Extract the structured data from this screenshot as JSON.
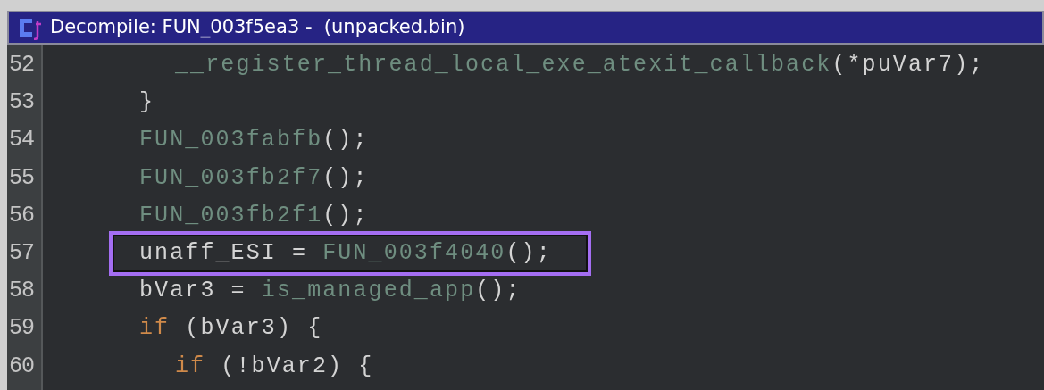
{
  "window": {
    "title": "Decompile: FUN_003f5ea3 -  (unpacked.bin)"
  },
  "code_lines": [
    {
      "children": [
        {
          "number": "52",
          "highlighted": false,
          "tokens": [
            {
              "kind": "function",
              "text": "__register_thread_local_exe_atexit_callback"
            },
            {
              "kind": "plain",
              "text": "(*puVar7);"
            }
          ]
        }
      ]
    },
    {
      "number": "53",
      "highlighted": false,
      "tokens": [
        {
          "kind": "plain",
          "text": "}"
        }
      ]
    },
    {
      "number": "54",
      "highlighted": false,
      "tokens": [
        {
          "kind": "function",
          "text": "FUN_003fabfb"
        },
        {
          "kind": "plain",
          "text": "();"
        }
      ]
    },
    {
      "number": "55",
      "highlighted": false,
      "tokens": [
        {
          "kind": "function",
          "text": "FUN_003fb2f7"
        },
        {
          "kind": "plain",
          "text": "();"
        }
      ]
    },
    {
      "number": "56",
      "highlighted": false,
      "tokens": [
        {
          "kind": "function",
          "text": "FUN_003fb2f1"
        },
        {
          "kind": "plain",
          "text": "();"
        }
      ]
    },
    {
      "number": "57",
      "highlighted": true,
      "tokens": [
        {
          "kind": "plain",
          "text": "unaff_ESI = "
        },
        {
          "kind": "function",
          "text": "FUN_003f4040"
        },
        {
          "kind": "plain",
          "text": "();"
        }
      ]
    },
    {
      "number": "58",
      "highlighted": false,
      "tokens": [
        {
          "kind": "plain",
          "text": "bVar3 = "
        },
        {
          "kind": "function",
          "text": "is_managed_app"
        },
        {
          "kind": "plain",
          "text": "();"
        }
      ]
    },
    {
      "number": "59",
      "highlighted": false,
      "tokens": [
        {
          "kind": "keyword",
          "text": "if"
        },
        {
          "kind": "plain",
          "text": " (bVar3) {"
        }
      ],
      "children": [
        {
          "number": "60",
          "highlighted": false,
          "tokens": [
            {
              "kind": "keyword",
              "text": "if"
            },
            {
              "kind": "plain",
              "text": " (!bVar2) {"
            }
          ]
        }
      ]
    }
  ]
}
